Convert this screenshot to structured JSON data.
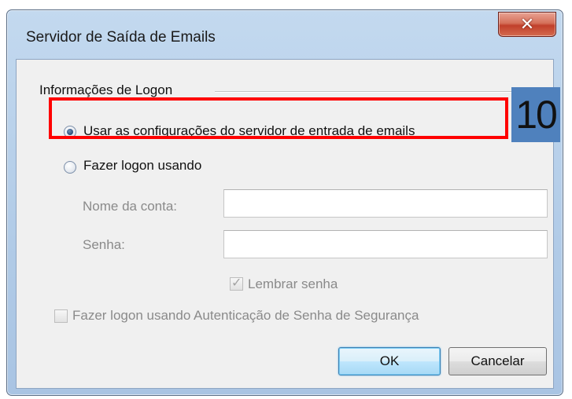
{
  "top_strip": {
    "left_text": "",
    "right_text": ""
  },
  "window": {
    "title": "Servidor de Saída de Emails",
    "close_icon": "close-icon"
  },
  "logon_group": {
    "label": "Informações de Logon",
    "option_incoming": {
      "label": "Usar as configurações do servidor de entrada de emails",
      "checked": true
    },
    "option_logon": {
      "label": "Fazer logon usando",
      "checked": false
    },
    "account_name": {
      "label": "Nome da conta:",
      "value": ""
    },
    "password": {
      "label": "Senha:",
      "value": ""
    },
    "remember_password": {
      "label": "Lembrar senha",
      "checked": true
    }
  },
  "spa": {
    "label": "Fazer logon usando Autenticação de Senha de Segurança",
    "checked": false
  },
  "buttons": {
    "ok": "OK",
    "cancel": "Cancelar"
  },
  "annotation": {
    "step_number": "10",
    "highlight_color": "#ff0000",
    "badge_color": "#4f81bd"
  }
}
